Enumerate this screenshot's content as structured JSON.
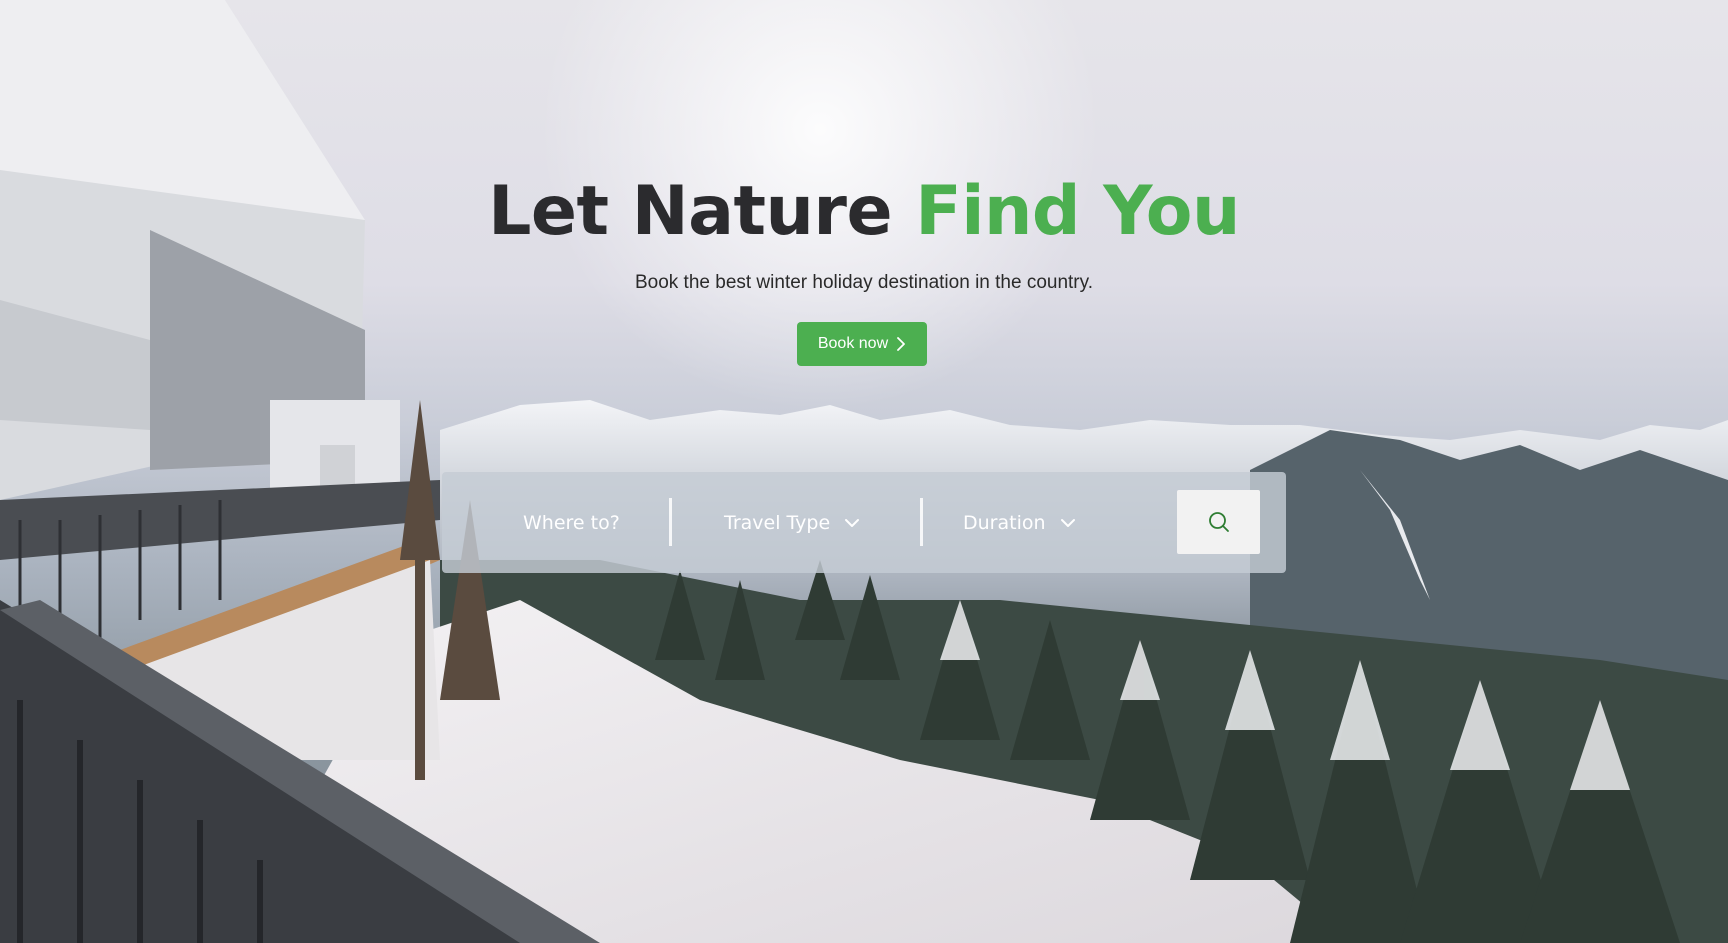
{
  "hero": {
    "title_main": "Let Nature",
    "title_accent": "Find You",
    "subtitle": "Book the best winter holiday destination in the country.",
    "cta_label": "Book now"
  },
  "search": {
    "where_label": "Where to?",
    "travel_type_label": "Travel Type",
    "duration_label": "Duration"
  },
  "icons": {
    "cta": "chevron-right-icon",
    "dropdown": "chevron-down-icon",
    "search": "search-icon"
  },
  "colors": {
    "accent": "#4caf50",
    "title": "#2b2b2e",
    "search_bar": "#c4ccd4"
  }
}
